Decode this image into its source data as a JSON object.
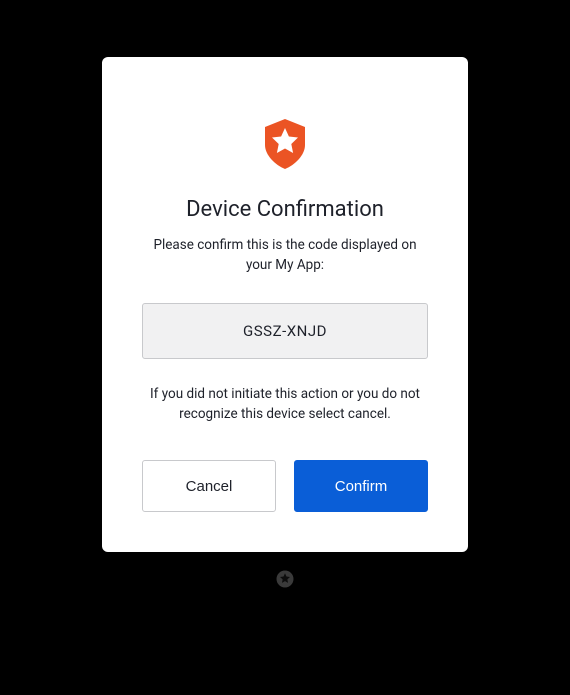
{
  "dialog": {
    "title": "Device Confirmation",
    "subtitle": "Please confirm this is the code displayed on your My App:",
    "code": "GSSZ-XNJD",
    "instruction": "If you did not initiate this action or you do not recognize this device select cancel.",
    "cancel_label": "Cancel",
    "confirm_label": "Confirm"
  },
  "brand": {
    "primary_color": "#eb5424",
    "confirm_color": "#0a5ed7"
  }
}
